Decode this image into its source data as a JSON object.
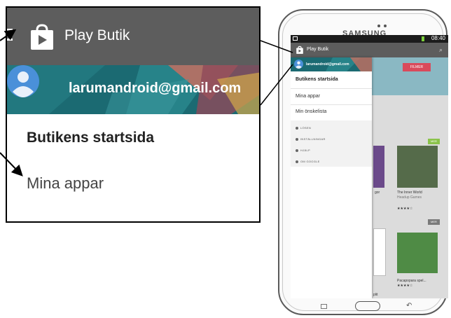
{
  "zoom": {
    "app_title": "Play Butik",
    "account_email": "larumandroid@gmail.com",
    "menu_home": "Butikens startsida",
    "menu_my_apps": "Mina appar"
  },
  "tablet": {
    "brand": "SAMSUNG",
    "status_time": "08:40",
    "app_title": "Play Butik",
    "account_email": "larumandroid@gmail.com",
    "drawer_items": [
      "Butikens startsida",
      "Mina appar",
      "Min önskelista"
    ],
    "drawer_secondary": [
      "LÖSEN",
      "INSTÄLLNINGAR",
      "HJÄLP",
      "OM GOOGLE"
    ],
    "content": {
      "banner_label": "FILMER",
      "more_label": "MER",
      "card1_title": "The Inner World",
      "card1_sub": "Headup Games",
      "card2_title": "Pacapopara spel...",
      "card_rating": "★★★★☆",
      "cut_text_1": "gor",
      "cut_text_2": "plit"
    }
  },
  "colors": {
    "toolbar": "#5d5d5d",
    "header_teal": "#1b6a72",
    "avatar_blue": "#4a90d9"
  }
}
